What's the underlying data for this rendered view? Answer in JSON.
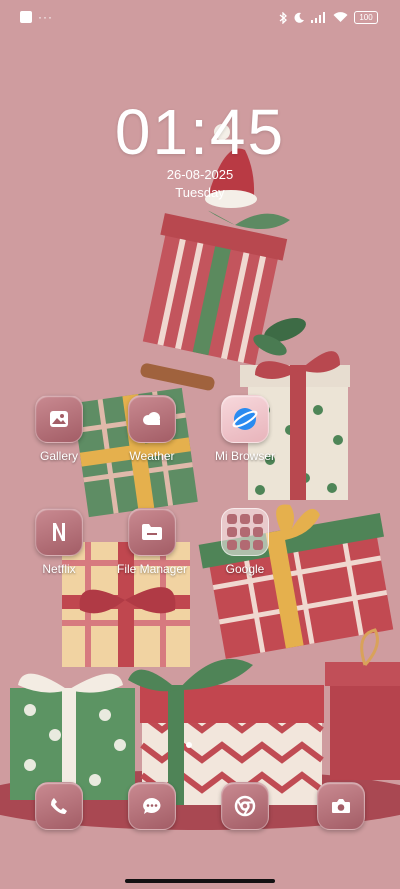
{
  "status_bar": {
    "battery": "100"
  },
  "lock": {
    "time": "01:45",
    "date": "26-08-2025",
    "day": "Tuesday"
  },
  "apps": [
    {
      "label": "Gallery",
      "icon": "gallery-icon"
    },
    {
      "label": "Weather",
      "icon": "weather-icon"
    },
    {
      "label": "Mi Browser",
      "icon": "browser-icon"
    },
    {
      "label": "Netflix",
      "icon": "netflix-icon"
    },
    {
      "label": "File Manager",
      "icon": "file-manager-icon"
    },
    {
      "label": "Google",
      "icon": "google-folder-icon"
    }
  ],
  "dock": [
    {
      "icon": "phone-icon"
    },
    {
      "icon": "messages-icon"
    },
    {
      "icon": "chrome-icon"
    },
    {
      "icon": "camera-icon"
    }
  ],
  "colors": {
    "background": "#cf9c9f",
    "icon_bg": "#b26a72",
    "gift_red": "#b8484f",
    "gift_green": "#5d8a62",
    "ribbon_gold": "#e5b04d"
  }
}
